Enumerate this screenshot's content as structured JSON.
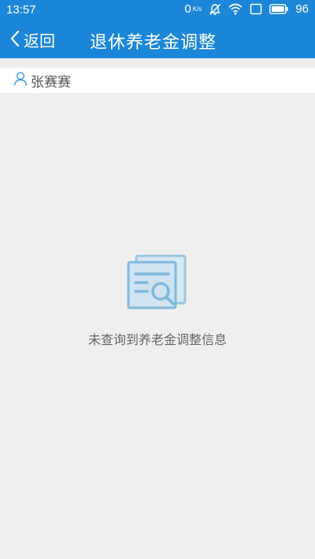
{
  "status_bar": {
    "time": "13:57",
    "net_speed": "0",
    "net_speed_unit": "K/s",
    "battery": "96",
    "icons": [
      "mute-icon",
      "wifi-icon",
      "screen-icon",
      "battery-icon"
    ]
  },
  "nav": {
    "back_label": "返回",
    "title": "退休养老金调整",
    "color": "#1c87d8"
  },
  "user": {
    "name": "张赛赛",
    "icon": "user-icon"
  },
  "empty_state": {
    "icon": "document-search-icon",
    "message": "未查询到养老金调整信息"
  }
}
